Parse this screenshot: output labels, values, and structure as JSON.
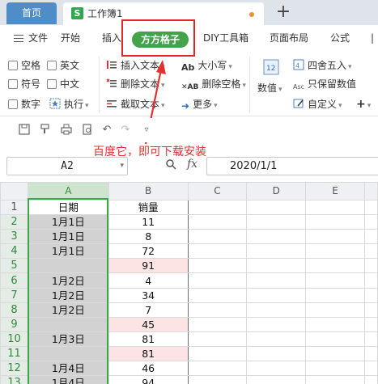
{
  "tabs": {
    "home": "首页",
    "document": "工作簿1",
    "doc_icon_letter": "S",
    "add": "+"
  },
  "menu": {
    "file": "文件",
    "items": [
      "开始",
      "插入",
      "方方格子",
      "DIY工具箱",
      "页面布局",
      "公式"
    ]
  },
  "ribbon": {
    "checkboxes": {
      "space": "空格",
      "english": "英文",
      "symbol": "符号",
      "chinese": "中文",
      "number": "数字"
    },
    "execute": "执行",
    "insert_text": "插入文本",
    "delete_text": "删除文本",
    "extract_text": "截取文本",
    "case": "大小写",
    "delete_space": "删除空格",
    "more": "更多",
    "value": "数值",
    "round": "四舍五入",
    "keep_value": "只保留数值",
    "custom": "自定义"
  },
  "annotation": "百度它，即可下载安装",
  "formula_bar": {
    "cell_ref": "A2",
    "fx": "fx",
    "value": "2020/1/1"
  },
  "sheet": {
    "columns": [
      "A",
      "B",
      "C",
      "D",
      "E"
    ],
    "rows": [
      {
        "num": "1",
        "a": "日期",
        "b": "销量",
        "pink": false
      },
      {
        "num": "2",
        "a": "1月1日",
        "b": "11",
        "pink": false
      },
      {
        "num": "3",
        "a": "1月1日",
        "b": "8",
        "pink": false
      },
      {
        "num": "4",
        "a": "1月1日",
        "b": "72",
        "pink": false
      },
      {
        "num": "5",
        "a": "",
        "b": "91",
        "pink": true
      },
      {
        "num": "6",
        "a": "1月2日",
        "b": "4",
        "pink": false
      },
      {
        "num": "7",
        "a": "1月2日",
        "b": "34",
        "pink": false
      },
      {
        "num": "8",
        "a": "1月2日",
        "b": "7",
        "pink": false
      },
      {
        "num": "9",
        "a": "",
        "b": "45",
        "pink": true
      },
      {
        "num": "10",
        "a": "1月3日",
        "b": "81",
        "pink": false
      },
      {
        "num": "11",
        "a": "",
        "b": "81",
        "pink": true
      },
      {
        "num": "12",
        "a": "1月4日",
        "b": "46",
        "pink": false
      },
      {
        "num": "13",
        "a": "1月4日",
        "b": "94",
        "pink": false
      }
    ]
  },
  "colors": {
    "tab_home": "#4f8dc8",
    "pill": "#44a24a",
    "highlight_box": "#e02828",
    "selection": "#3aa84a",
    "annotation": "#e53030",
    "pink_cell": "#fde4e4"
  }
}
